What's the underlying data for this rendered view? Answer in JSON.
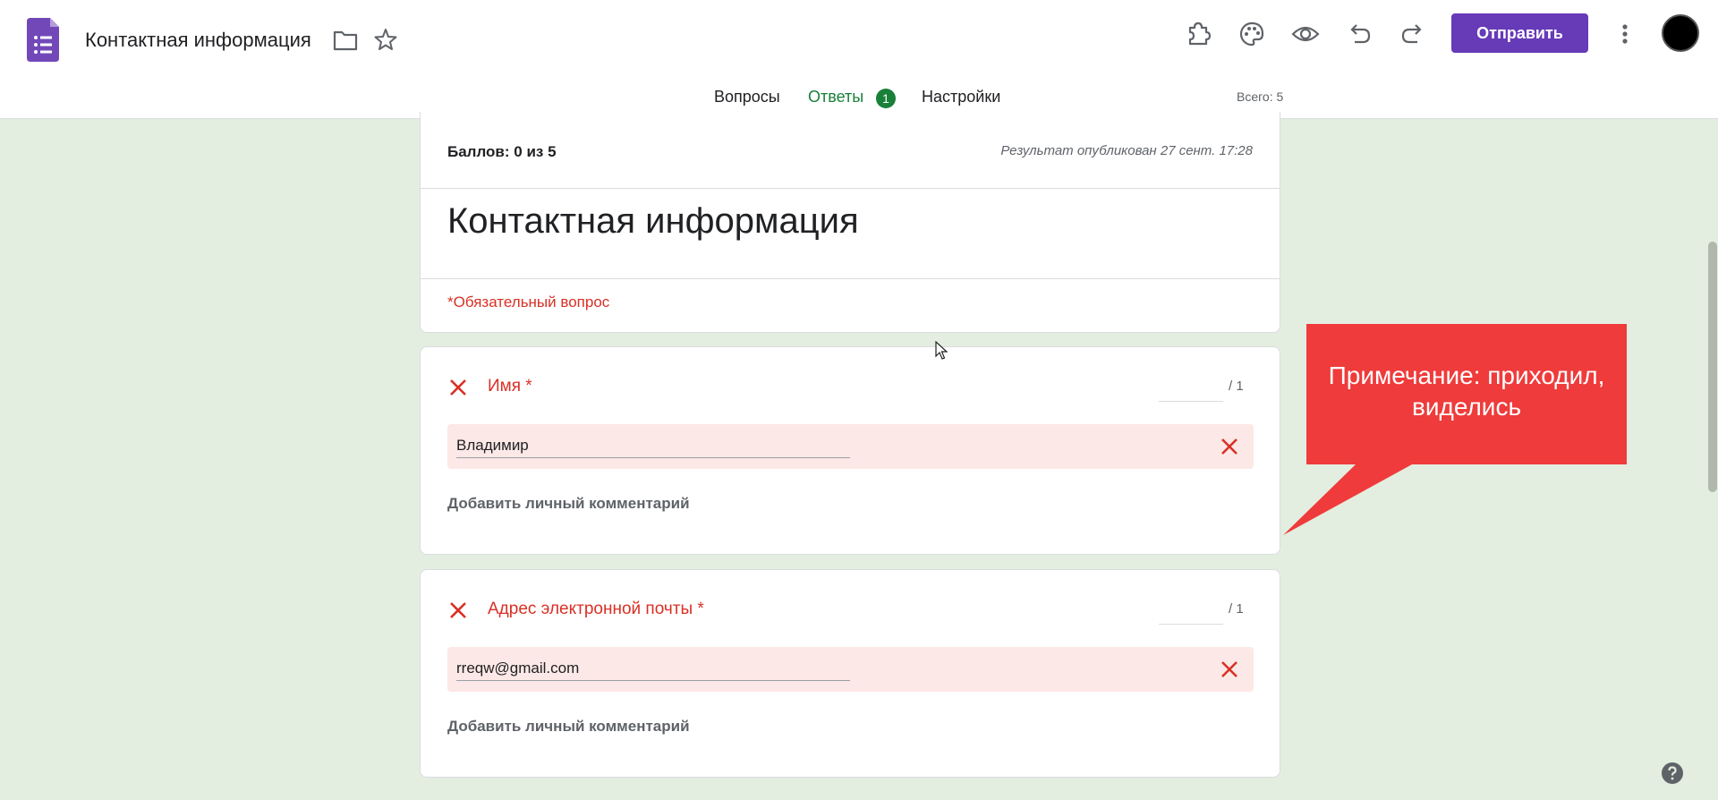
{
  "header": {
    "title": "Контактная информация",
    "send_label": "Отправить",
    "total": "Всего: 5"
  },
  "tabs": [
    {
      "label": "Вопросы"
    },
    {
      "label": "Ответы",
      "badge": "1"
    },
    {
      "label": "Настройки"
    }
  ],
  "icons": {
    "app": "forms-logo-icon",
    "folder": "folder-icon",
    "star": "star-icon",
    "addons": "puzzle-icon",
    "theme": "palette-icon",
    "preview": "eye-icon",
    "undo": "undo-icon",
    "redo": "redo-icon",
    "more": "more-vert-icon",
    "help": "help-icon"
  },
  "colors": {
    "accent": "#673ab7",
    "tab_active": "#188038",
    "error": "#d93025",
    "answer_bg": "#fce8e6",
    "page_bg": "#e3eee0",
    "callout": "#ef3b3b"
  },
  "summary": {
    "score": "Баллов: 0 из 5",
    "published": "Результат опубликован 27 сент. 17:28",
    "form_title": "Контактная информация",
    "required_note": "*Обязательный вопрос"
  },
  "questions": [
    {
      "title": "Имя *",
      "score_max": "/ 1",
      "answer": "Владимир",
      "add_comment": "Добавить личный комментарий"
    },
    {
      "title": "Адрес электронной почты *",
      "score_max": "/ 1",
      "answer": "rreqw@gmail.com",
      "add_comment": "Добавить личный комментарий"
    }
  ],
  "callout": {
    "line1": "Примечание: приходил,",
    "line2": "виделись"
  }
}
